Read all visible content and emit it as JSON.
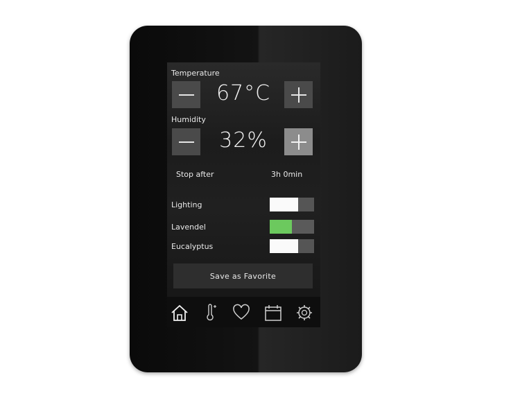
{
  "temperature": {
    "label": "Temperature",
    "value": "67°C",
    "minus": "−",
    "plus": "+"
  },
  "humidity": {
    "label": "Humidity",
    "value": "32%",
    "minus": "−",
    "plus": "+"
  },
  "timer": {
    "label": "Stop after",
    "value": "3h 0min"
  },
  "toggles": [
    {
      "label": "Lighting",
      "state": "off"
    },
    {
      "label": "Lavendel",
      "state": "on"
    },
    {
      "label": "Eucalyptus",
      "state": "off"
    }
  ],
  "favorite_button": {
    "label": "Save as Favorite"
  },
  "nav": [
    {
      "icon": "home-icon",
      "active": true
    },
    {
      "icon": "thermometer-icon",
      "active": false
    },
    {
      "icon": "heart-icon",
      "active": false
    },
    {
      "icon": "calendar-icon",
      "active": false
    },
    {
      "icon": "gear-icon",
      "active": false
    }
  ],
  "colors": {
    "toggle_on": "#6cc95e",
    "button": "#4a4a4a",
    "button_active": "#8c8c8c"
  }
}
